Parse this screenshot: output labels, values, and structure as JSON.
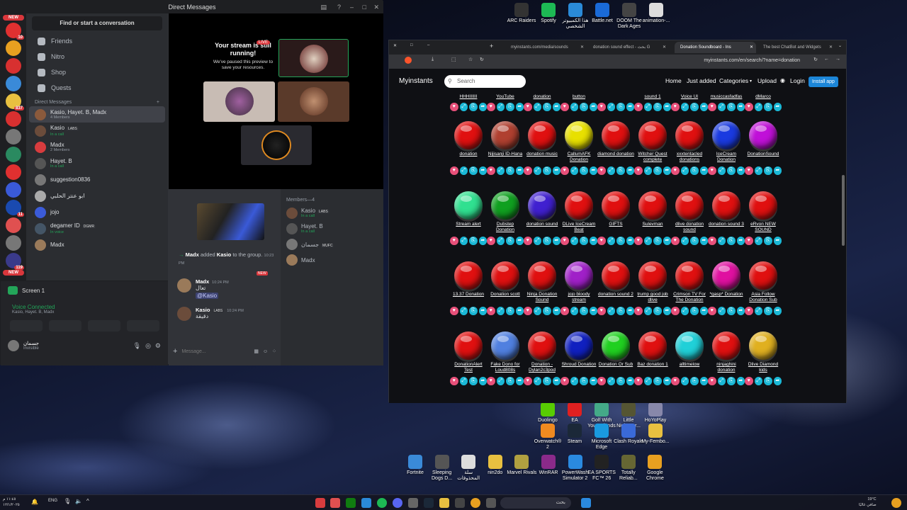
{
  "discord": {
    "title": "Direct Messages",
    "find": "Find or start a conversation",
    "nav": [
      "Friends",
      "Nitro",
      "Shop",
      "Quests"
    ],
    "dm_header": "Direct Messages",
    "dms": [
      {
        "name": "Kasio, Hayet. B, Madx",
        "sub": "4 Members",
        "color": "#8b5a3c",
        "status": "gray"
      },
      {
        "name": "Kasio",
        "sub": "In a call",
        "color": "#6b4c3b",
        "tag": "LABS",
        "status": "green"
      },
      {
        "name": "Madx",
        "sub": "2 Members",
        "color": "#d83c3e",
        "status": "gray"
      },
      {
        "name": "Hayet. B",
        "sub": "In a call",
        "color": "#555",
        "status": "green"
      },
      {
        "name": "suggestion0836",
        "sub": "",
        "color": "#777",
        "status": "gray"
      },
      {
        "name": "ابو عنتر الحلبي",
        "sub": "",
        "color": "#aaa",
        "status": "gray"
      },
      {
        "name": "jojo",
        "sub": "",
        "color": "#3b5bd8",
        "status": "gray"
      },
      {
        "name": "degamer ID",
        "sub": "In voice",
        "color": "#456",
        "tag": "DGMR",
        "status": "green"
      },
      {
        "name": "Madx",
        "sub": "",
        "color": "#9a7a5a",
        "status": "gray"
      }
    ],
    "screen": "Screen 1",
    "voice_connected": "Voice Connected",
    "voice_members": "Kasio, Hayet. B, Madx",
    "user": "جسمان",
    "user_status": "Invisible",
    "stream_title": "Your stream is still running!",
    "stream_body": "We've paused this preview to save your resources.",
    "live": "LIVE",
    "members_header": "Members—4",
    "members": [
      {
        "name": "Kasio",
        "tag": "LABS",
        "sub": "In a call"
      },
      {
        "name": "Hayet. B",
        "sub": "In a call"
      },
      {
        "name": "جسمان",
        "tag": "MUFC"
      },
      {
        "name": "Madx"
      }
    ],
    "added_msg": {
      "actor": "Madx",
      "middle": " added ",
      "target": "Kasio",
      "end": " to the group.",
      "time": "10:23 PM"
    },
    "new": "NEW",
    "messages": [
      {
        "name": "Madx",
        "time": "10:24 PM",
        "text": "تعال",
        "mention": "@Kasio"
      },
      {
        "name": "Kasio",
        "tag": "LABS",
        "time": "10:24 PM",
        "text": "دقيقة"
      }
    ],
    "msg_placeholder": "Message...",
    "server_badges": [
      "NEW",
      "10",
      "",
      "",
      "",
      "837",
      "",
      "",
      "",
      "",
      "",
      "11",
      "",
      "",
      "119",
      "NEW"
    ]
  },
  "browser": {
    "tabs": [
      {
        "label": "myinstants.com/media/sounds"
      },
      {
        "label": "donation sound effect - بحث G"
      },
      {
        "label": "Donation Soundboard - Ins",
        "active": true
      },
      {
        "label": "The best ChatBot and Widgets"
      }
    ],
    "url": "myinstants.com/en/search/?name=donation",
    "brand": "Myinstants",
    "search_placeholder": "Search",
    "menu": [
      "Home",
      "Just added",
      "Categories",
      "Upload",
      "Login"
    ],
    "install": "Install app",
    "top_row": [
      "HHHIIIIII",
      "YouTube",
      "donation",
      "button",
      "",
      "sound 1",
      "Voice UI",
      "musiccasfadfas",
      "dMarco"
    ],
    "buttons": [
      [
        {
          "l": "donation",
          "c": "#e01010"
        },
        {
          "l": "Nijisanji ID-Hana",
          "c": "#b04030"
        },
        {
          "l": "donation music",
          "c": "#e01010"
        },
        {
          "l": "CallumAFK Donation",
          "c": "#e8e000"
        },
        {
          "l": "diamond donation",
          "c": "#e01010"
        },
        {
          "l": "Witcher Quest complete",
          "c": "#e01010"
        },
        {
          "l": "xxxtentacled donations",
          "c": "#e01010"
        },
        {
          "l": "IceCream Donation",
          "c": "#1a3ae0"
        },
        {
          "l": "DonationSound",
          "c": "#c010d8"
        }
      ],
      [
        {
          "l": "Stream alert",
          "c": "#30e090"
        },
        {
          "l": "Dubstep Donation",
          "c": "#10a020"
        },
        {
          "l": "donation sound",
          "c": "#4020d0"
        },
        {
          "l": "DLive IceCream Beat",
          "c": "#e01010"
        },
        {
          "l": "GIFTS",
          "c": "#e01010"
        },
        {
          "l": "Sulevman",
          "c": "#e01010"
        },
        {
          "l": "dlive donation sound",
          "c": "#e01010"
        },
        {
          "l": "donation sound 3",
          "c": "#e01010"
        },
        {
          "l": "eRvon NEW SOUND",
          "c": "#e01010"
        }
      ],
      [
        {
          "l": "13.37 Donation",
          "c": "#e01010"
        },
        {
          "l": "Donation scott",
          "c": "#e01010"
        },
        {
          "l": "Ninja Donation Sound",
          "c": "#e01010"
        },
        {
          "l": "jojo bloody stream",
          "c": "#a020c8"
        },
        {
          "l": "donation sound 2",
          "c": "#e01010"
        },
        {
          "l": "trump good job dlive",
          "c": "#e01010"
        },
        {
          "l": "Crimson TV For The Donation",
          "c": "#e01010"
        },
        {
          "l": "*gasp* Donation",
          "c": "#e010a0"
        },
        {
          "l": "Asia Follow Donation Sub",
          "c": "#e01010"
        }
      ],
      [
        {
          "l": "DonationAlert Test",
          "c": "#e01010"
        },
        {
          "l": "Fake Dono for Loud808s",
          "c": "#5080e0"
        },
        {
          "l": "Donation - Dylan2c3pod",
          "c": "#e01010"
        },
        {
          "l": "Shroud Donation",
          "c": "#1020c0"
        },
        {
          "l": "Donation Or Sub",
          "c": "#20d020"
        },
        {
          "l": "Baz donation 1",
          "c": "#e01010"
        },
        {
          "l": "alltimelow",
          "c": "#20d0d8"
        },
        {
          "l": "ninjaghini donation",
          "c": "#e01010"
        },
        {
          "l": "Dlive Diamond kids",
          "c": "#e0b020"
        }
      ]
    ]
  },
  "desktop": {
    "top": [
      {
        "l": "ARC Raiders",
        "c": "#333"
      },
      {
        "l": "Spotify",
        "c": "#1db954"
      },
      {
        "l": "هذا الكمبيوتر الشخصي",
        "c": "#2a8ad8"
      },
      {
        "l": "Battle.net",
        "c": "#1a6ad8"
      },
      {
        "l": "DOOM The Dark Ages",
        "c": "#444"
      },
      {
        "l": "animation-...",
        "c": "#ddd"
      }
    ],
    "bottom1": [
      {
        "l": "Duolingo",
        "c": "#58cc02"
      },
      {
        "l": "EA",
        "c": "#e02020"
      },
      {
        "l": "Golf With Your Friends",
        "c": "#4a8"
      },
      {
        "l": "Little Nightmar...",
        "c": "#553"
      },
      {
        "l": "HoYoPlay",
        "c": "#88a"
      }
    ],
    "bottom2": [
      {
        "l": "Overwatch® 2",
        "c": "#f08a20"
      },
      {
        "l": "Steam",
        "c": "#1b2838"
      },
      {
        "l": "Microsoft Edge",
        "c": "#1a9ae0"
      },
      {
        "l": "Clash Royale",
        "c": "#3a6ad8"
      },
      {
        "l": "My-Fembo...",
        "c": "#e8c040"
      }
    ],
    "bottom3": [
      {
        "l": "Fortnite",
        "c": "#3a8ad8"
      },
      {
        "l": "Sleeping Dogs D...",
        "c": "#555"
      },
      {
        "l": "سلة المحذوفات",
        "c": "#ddd"
      },
      {
        "l": "nin2do",
        "c": "#e8c040"
      },
      {
        "l": "Marvel Rivals",
        "c": "#b0a040"
      },
      {
        "l": "WinRAR",
        "c": "#8a2a8a"
      },
      {
        "l": "PowerWash Simulator 2",
        "c": "#2a8ae0"
      },
      {
        "l": "EA SPORTS FC™ 26",
        "c": "#222"
      },
      {
        "l": "Totally Reliab...",
        "c": "#663"
      },
      {
        "l": "Google Chrome",
        "c": "#e8a020"
      }
    ]
  },
  "taskbar": {
    "lang": "ENG",
    "search": "بحث",
    "time": "١١:٤٥ م",
    "date": "١٢/١/٢٠٢٥",
    "weather": "19°C",
    "weather_desc": "صافي غالبًا"
  }
}
